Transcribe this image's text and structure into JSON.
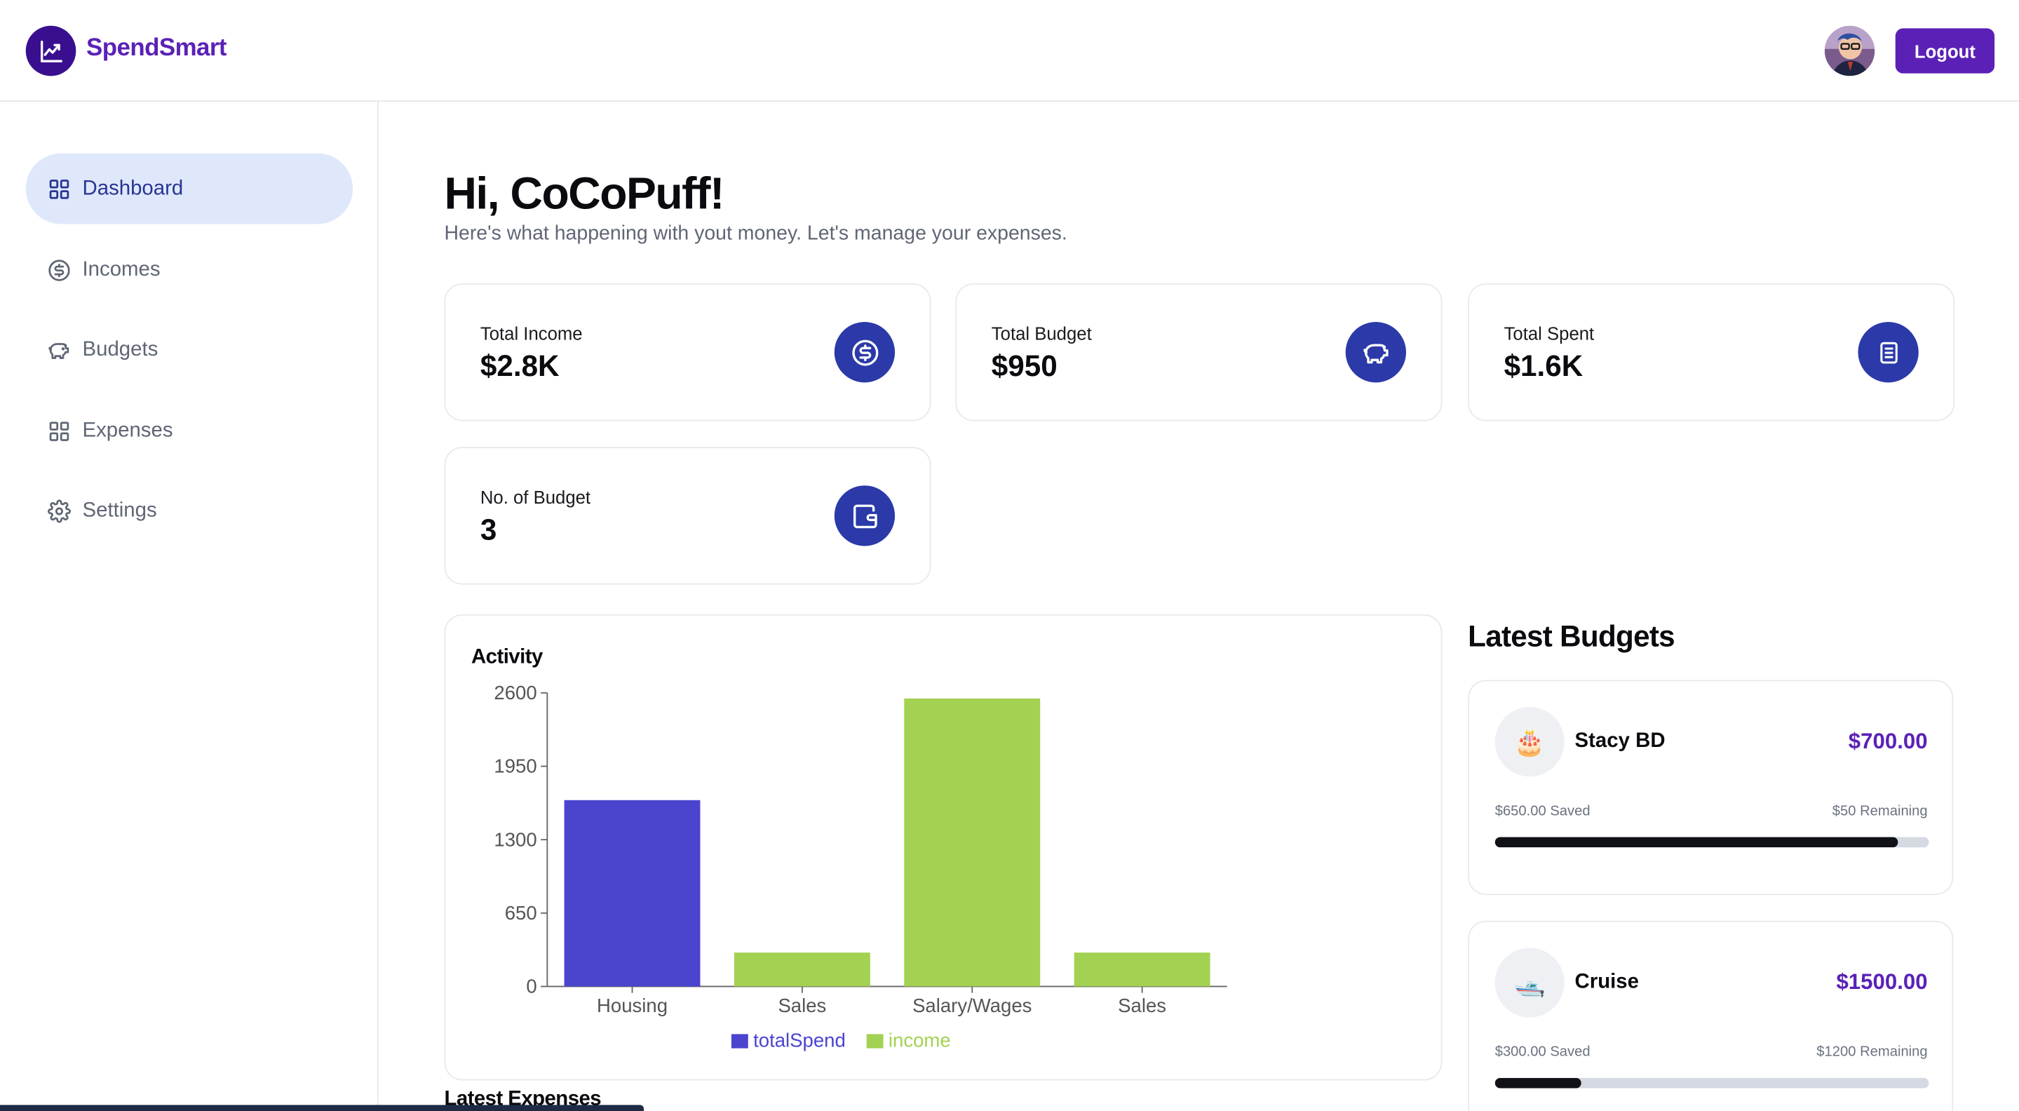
{
  "app": {
    "name": "SpendSmart"
  },
  "header": {
    "logout_label": "Logout"
  },
  "sidebar": {
    "items": [
      {
        "label": "Dashboard",
        "icon": "dashboard-grid-icon",
        "active": true
      },
      {
        "label": "Incomes",
        "icon": "dollar-circle-icon",
        "active": false
      },
      {
        "label": "Budgets",
        "icon": "piggy-bank-icon",
        "active": false
      },
      {
        "label": "Expenses",
        "icon": "grid-icon",
        "active": false
      },
      {
        "label": "Settings",
        "icon": "gear-icon",
        "active": false
      }
    ]
  },
  "main": {
    "greeting": "Hi, CoCoPuff!",
    "subtitle": "Here's what happening with yout money. Let's manage your expenses.",
    "stats": [
      {
        "label": "Total Income",
        "value": "$2.8K",
        "icon": "dollar-circle-icon"
      },
      {
        "label": "Total Budget",
        "value": "$950",
        "icon": "piggy-bank-icon"
      },
      {
        "label": "Total Spent",
        "value": "$1.6K",
        "icon": "receipt-icon"
      },
      {
        "label": "No. of Budget",
        "value": "3",
        "icon": "wallet-icon"
      }
    ],
    "activity_title": "Activity",
    "latest_expenses_title": "Latest Expenses",
    "latest_budgets_title": "Latest Budgets",
    "budgets": [
      {
        "emoji": "🎂",
        "name": "Stacy BD",
        "amount": "$700.00",
        "saved": "$650.00 Saved",
        "remaining": "$50 Remaining",
        "progress": 0.93
      },
      {
        "emoji": "🛥️",
        "name": "Cruise",
        "amount": "$1500.00",
        "saved": "$300.00 Saved",
        "remaining": "$1200 Remaining",
        "progress": 0.2
      }
    ]
  },
  "colors": {
    "accent": "#5b21b6",
    "stat_icon_bg": "#2b3aa8",
    "totalSpend": "#4a44cf",
    "income": "#a3d152"
  },
  "chart_data": {
    "type": "bar",
    "categories": [
      "Housing",
      "Sales",
      "Salary/Wages",
      "Sales"
    ],
    "series": [
      {
        "name": "totalSpend",
        "values": [
          1650,
          null,
          null,
          null
        ],
        "color": "#4a44cf"
      },
      {
        "name": "income",
        "values": [
          null,
          300,
          2550,
          300
        ],
        "color": "#a3d152"
      }
    ],
    "yticks": [
      0,
      650,
      1300,
      1950,
      2600
    ],
    "ylim": [
      0,
      2600
    ],
    "legend": "bottom",
    "grid": false
  }
}
